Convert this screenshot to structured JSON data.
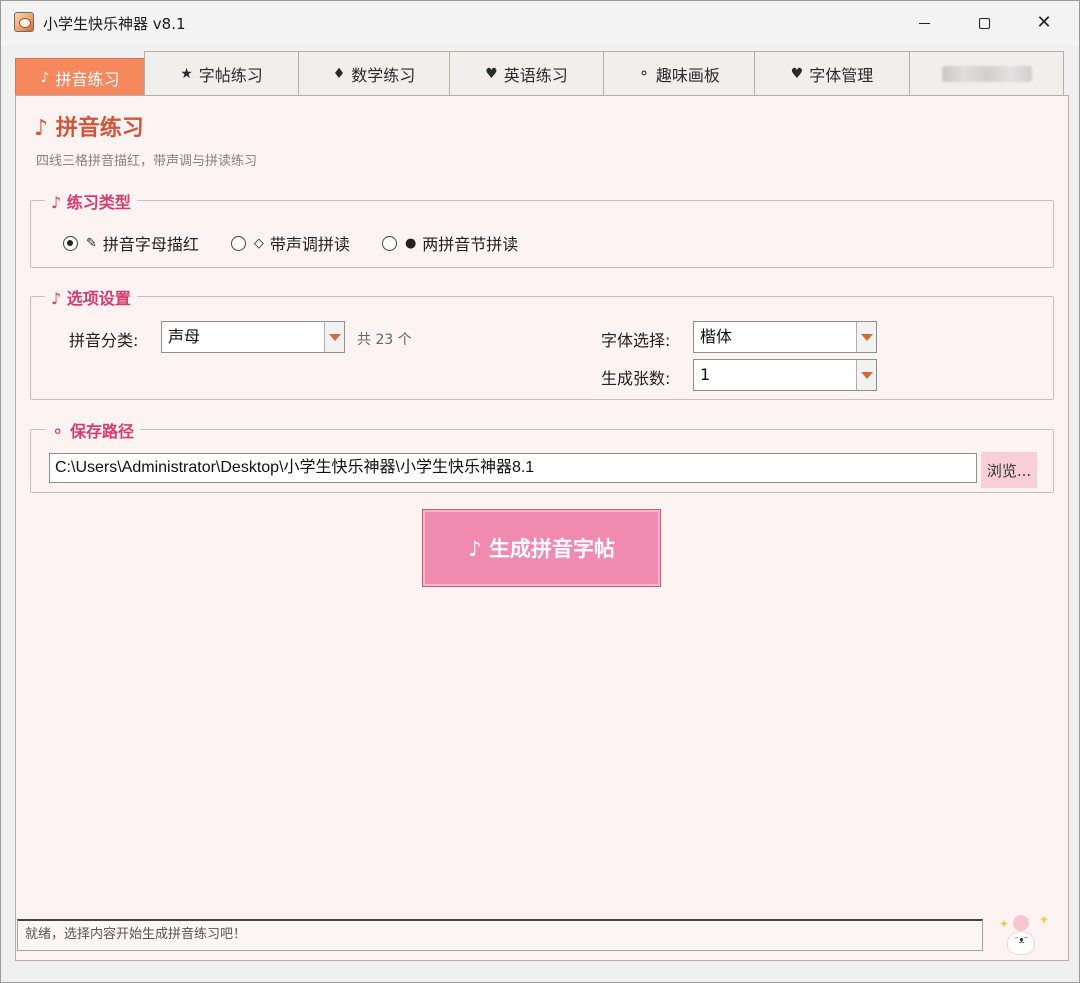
{
  "window": {
    "title": "小学生快乐神器 v8.1",
    "minimize_icon": "minimize-icon",
    "maximize_icon": "maximize-icon",
    "close_icon": "close-icon",
    "close_glyph": "✕"
  },
  "tabs": [
    {
      "icon": "♪",
      "label": "拼音练习",
      "active": true
    },
    {
      "icon": "★",
      "label": "字帖练习",
      "active": false
    },
    {
      "icon": "♦",
      "label": "数学练习",
      "active": false
    },
    {
      "icon": "♥",
      "label": "英语练习",
      "active": false
    },
    {
      "icon": "⚬",
      "label": "趣味画板",
      "active": false
    },
    {
      "icon": "♥",
      "label": "字体管理",
      "active": false
    }
  ],
  "colors": {
    "active_tab": "#f6885e",
    "title_red": "#d2553a",
    "section_pink": "#d83c6e",
    "generate_button": "#f08aae",
    "panel_bg": "#fdf3f3"
  },
  "page": {
    "title": "♪ 拼音练习",
    "subtitle": "四线三格拼音描红，带声调与拼读练习"
  },
  "practice_type": {
    "title": "♪ 练习类型",
    "options": [
      {
        "glyph": "✎",
        "label": "拼音字母描红",
        "checked": true
      },
      {
        "glyph": "◇",
        "label": "带声调拼读",
        "checked": false
      },
      {
        "glyph": "●",
        "label": "两拼音节拼读",
        "checked": false
      }
    ]
  },
  "options": {
    "title": "♪ 选项设置",
    "category_label": "拼音分类:",
    "category_value": "声母",
    "count_text": "共 23 个",
    "font_label": "字体选择:",
    "font_value": "楷体",
    "sheets_label": "生成张数:",
    "sheets_value": "1"
  },
  "save": {
    "title": "⚬ 保存路径",
    "path": "C:\\Users\\Administrator\\Desktop\\小学生快乐神器\\小学生快乐神器8.1",
    "browse_label": "浏览..."
  },
  "generate_button": "♪ 生成拼音字帖",
  "status": "就绪，选择内容开始生成拼音练习吧！"
}
